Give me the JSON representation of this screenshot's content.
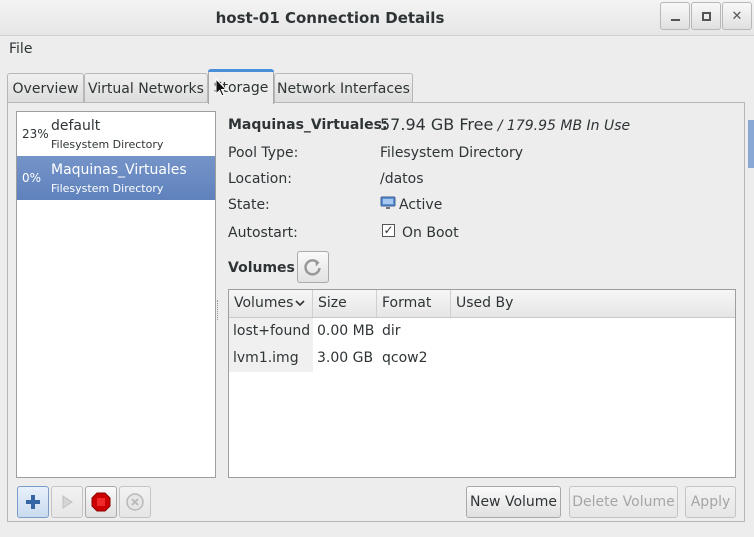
{
  "window": {
    "title": "host-01 Connection Details"
  },
  "menu": {
    "file": "File"
  },
  "tabs": [
    {
      "label": "Overview"
    },
    {
      "label": "Virtual Networks"
    },
    {
      "label": "Storage"
    },
    {
      "label": "Network Interfaces"
    }
  ],
  "pools": [
    {
      "percent": "23%",
      "name": "default",
      "type": "Filesystem Directory"
    },
    {
      "percent": "0%",
      "name": "Maquinas_Virtuales",
      "type": "Filesystem Directory"
    }
  ],
  "details": {
    "pool_name": "Maquinas_Virtuales:",
    "free": "57.94 GB Free",
    "in_use": " / 179.95 MB In Use",
    "pool_type_label": "Pool Type:",
    "pool_type": "Filesystem Directory",
    "location_label": "Location:",
    "location": "/datos",
    "state_label": "State:",
    "state": "Active",
    "autostart_label": "Autostart:",
    "autostart": "On Boot",
    "autostart_checked": "✓"
  },
  "volumes": {
    "title": "Volumes",
    "columns": [
      "Volumes",
      "Size",
      "Format",
      "Used By"
    ],
    "rows": [
      {
        "name": "lost+found",
        "size": "0.00 MB",
        "format": "dir",
        "used_by": ""
      },
      {
        "name": "lvm1.img",
        "size": "3.00 GB",
        "format": "qcow2",
        "used_by": ""
      }
    ]
  },
  "buttons": {
    "new_volume": "New Volume",
    "delete_volume": "Delete Volume",
    "apply": "Apply"
  },
  "colors": {
    "selection": "#5f82bd",
    "accent": "#4a90d9",
    "stop_red": "#cc0000",
    "add_blue": "#3465a4"
  }
}
